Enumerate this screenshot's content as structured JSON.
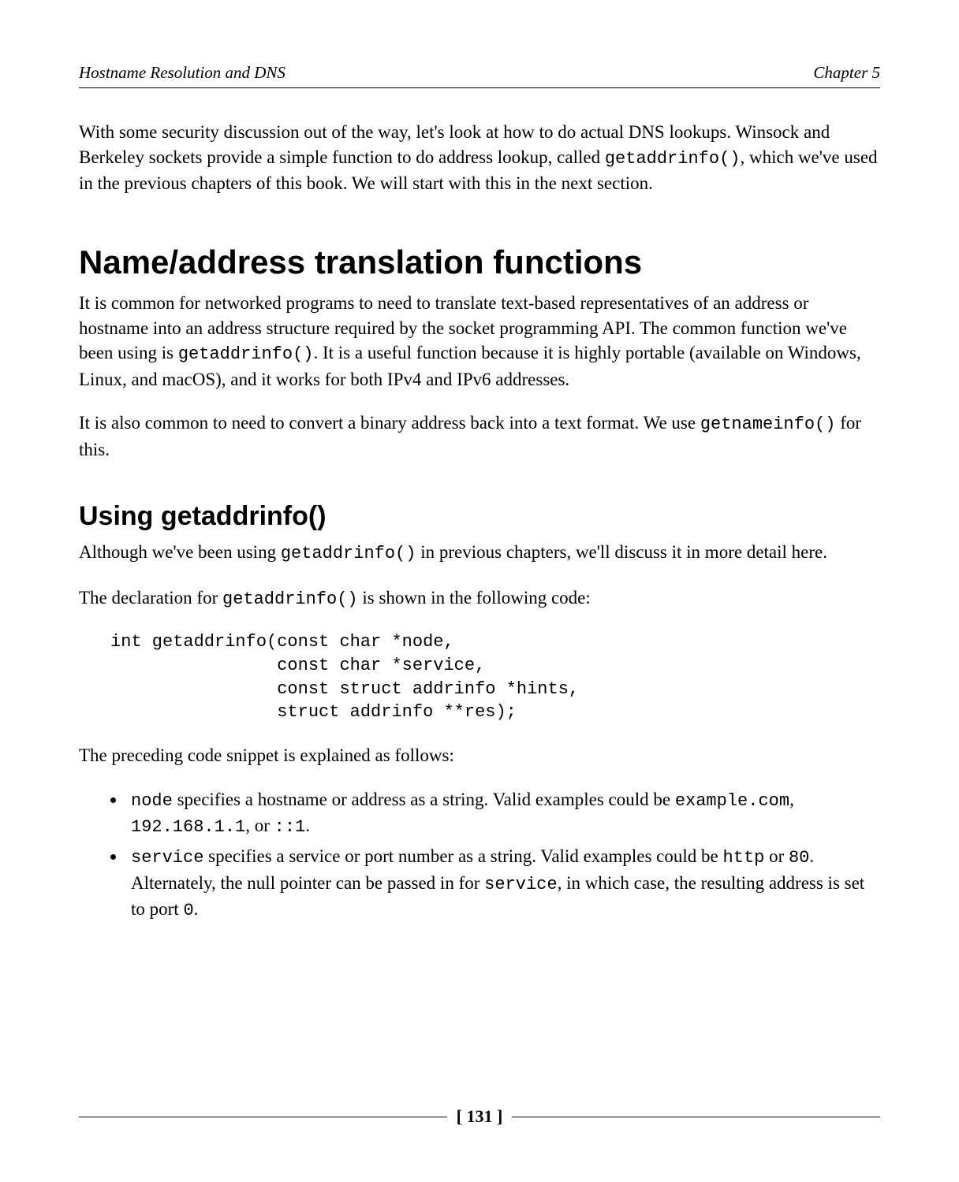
{
  "header": {
    "left": "Hostname Resolution and DNS",
    "right": "Chapter 5"
  },
  "intro": {
    "p1_a": "With some security discussion out of the way, let's look at how to do actual DNS lookups. Winsock and Berkeley sockets provide a simple function to do address lookup, called ",
    "p1_code": "getaddrinfo()",
    "p1_b": ", which we've used in the previous chapters of this book. We will start with this in the next section."
  },
  "section": {
    "title": "Name/address translation functions",
    "p1_a": "It is common for networked programs to need to translate text-based representatives of an address or hostname into an address structure required by the socket programming API. The common function we've been using is ",
    "p1_code": "getaddrinfo()",
    "p1_b": ". It is a useful function because it is highly portable (available on Windows, Linux, and macOS), and it works for both IPv4 and IPv6 addresses.",
    "p2_a": "It is also common to need to convert a binary address back into a text format. We use ",
    "p2_code": "getnameinfo()",
    "p2_b": " for this."
  },
  "subsection": {
    "title": "Using getaddrinfo()",
    "p1_a": "Although we've been using ",
    "p1_code": "getaddrinfo()",
    "p1_b": " in previous chapters, we'll discuss it in more detail here.",
    "p2_a": "The declaration for ",
    "p2_code": "getaddrinfo()",
    "p2_b": " is shown in the following code:",
    "code": "int getaddrinfo(const char *node,\n                const char *service,\n                const struct addrinfo *hints,\n                struct addrinfo **res);",
    "p3": "The preceding code snippet is explained as follows:",
    "bullets": {
      "b1": {
        "c1": "node",
        "t1": " specifies a hostname or address as a string. Valid examples could be ",
        "c2": "example.com",
        "t2": ", ",
        "c3": "192.168.1.1",
        "t3": ", or ",
        "c4": "::1",
        "t4": "."
      },
      "b2": {
        "c1": "service",
        "t1": " specifies a service or port number as a string. Valid examples could be ",
        "c2": "http",
        "t2": " or ",
        "c3": "80",
        "t3": ". Alternately, the null pointer can be passed in for ",
        "c4": "service",
        "t4": ", in which case, the resulting address is set to port ",
        "c5": "0",
        "t5": "."
      }
    }
  },
  "footer": {
    "page": "[ 131 ]"
  }
}
